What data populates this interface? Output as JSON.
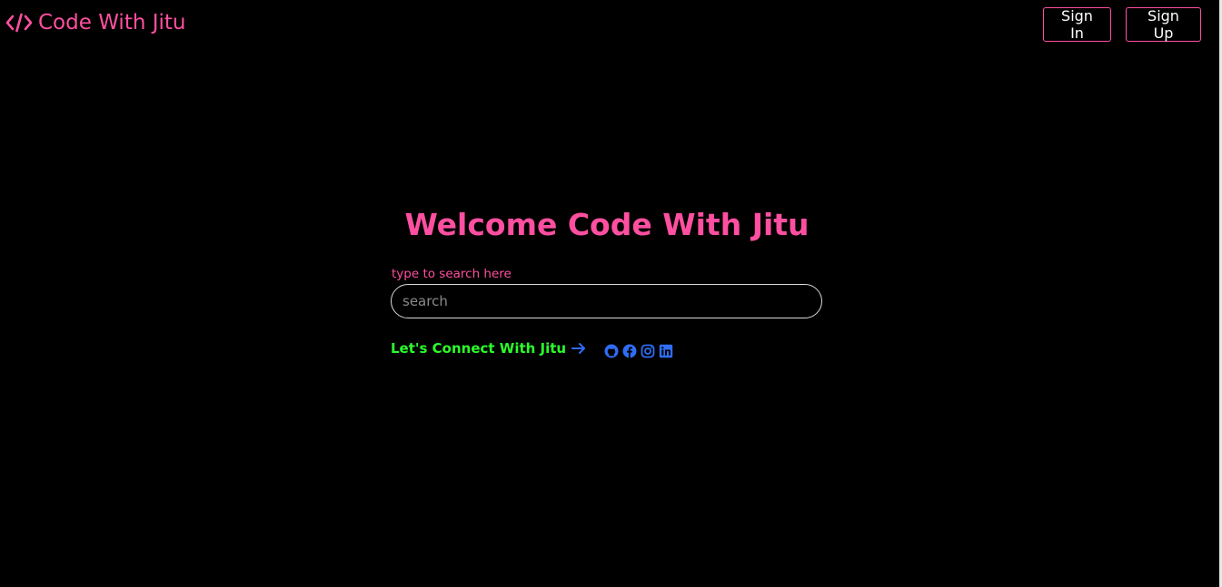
{
  "nav": {
    "brand_text": "Code With Jitu",
    "signin_label": "Sign In",
    "signup_label": "Sign Up"
  },
  "hero": {
    "title": "Welcome Code With Jitu",
    "search_label": "type to search here",
    "search_placeholder": "search",
    "search_value": ""
  },
  "connect": {
    "text": "Let's Connect With Jitu",
    "arrow_icon": "arrow-right-icon"
  },
  "socials": [
    {
      "icon": "github-icon"
    },
    {
      "icon": "facebook-icon"
    },
    {
      "icon": "instagram-icon"
    },
    {
      "icon": "linkedin-icon"
    }
  ],
  "colors": {
    "background": "#000000",
    "accent_pink": "#ff4fa0",
    "connect_green": "#2bff2b",
    "icon_blue": "#2f6df6"
  }
}
